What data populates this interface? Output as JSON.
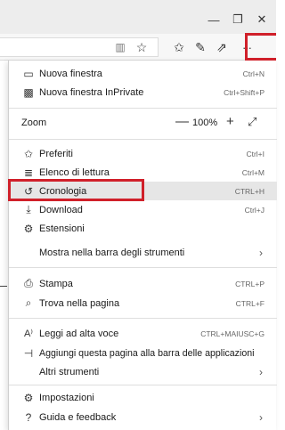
{
  "window": {
    "minimize_icon": "minimize-icon",
    "restore_icon": "restore-icon",
    "close_icon": "close-icon",
    "minimize_glyph": "—",
    "restore_glyph": "❐",
    "close_glyph": "✕"
  },
  "toolbar": {
    "reading_view_glyph": "▥",
    "favorite_glyph": "☆",
    "favorites_glyph": "✩",
    "notes_glyph": "✎",
    "share_glyph": "⇗",
    "more_glyph": "···"
  },
  "menu": {
    "new_window": {
      "label": "Nuova finestra",
      "shortcut": "Ctrl+N",
      "glyph": "▭"
    },
    "new_private": {
      "label": "Nuova finestra InPrivate",
      "shortcut": "Ctrl+Shift+P",
      "glyph": "▩"
    },
    "zoom": {
      "label": "Zoom",
      "minus": "—",
      "value": "100%",
      "plus": "+",
      "expand": "⤢"
    },
    "favorites": {
      "label": "Preferiti",
      "shortcut": "Ctrl+I",
      "glyph": "✩"
    },
    "reading_list": {
      "label": "Elenco di lettura",
      "shortcut": "Ctrl+M",
      "glyph": "≣"
    },
    "history": {
      "label": "Cronologia",
      "shortcut": "CTRL+H",
      "glyph": "↺"
    },
    "downloads": {
      "label": "Download",
      "shortcut": "Ctrl+J",
      "glyph": "⤓"
    },
    "extensions": {
      "label": "Estensioni",
      "glyph": "⚙"
    },
    "show_in_toolbar": {
      "label": "Mostra nella barra degli strumenti",
      "chevron": "›"
    },
    "print": {
      "label": "Stampa",
      "shortcut": "CTRL+P",
      "glyph": "⎙"
    },
    "find": {
      "label": "Trova nella pagina",
      "shortcut": "CTRL+F",
      "glyph": "⌕"
    },
    "read_aloud": {
      "label": "Leggi ad alta voce",
      "shortcut": "CTRL+MAIUSC+G",
      "glyph": "A⁾"
    },
    "pin_taskbar": {
      "label": "Aggiungi questa pagina alla barra delle applicazioni",
      "glyph": "⊣"
    },
    "more_tools": {
      "label": "Altri strumenti",
      "chevron": "›"
    },
    "settings": {
      "label": "Impostazioni",
      "glyph": "⚙"
    },
    "help": {
      "label": "Guida e feedback",
      "glyph": "?",
      "chevron": "›"
    }
  },
  "highlight_color": "#d0202a"
}
